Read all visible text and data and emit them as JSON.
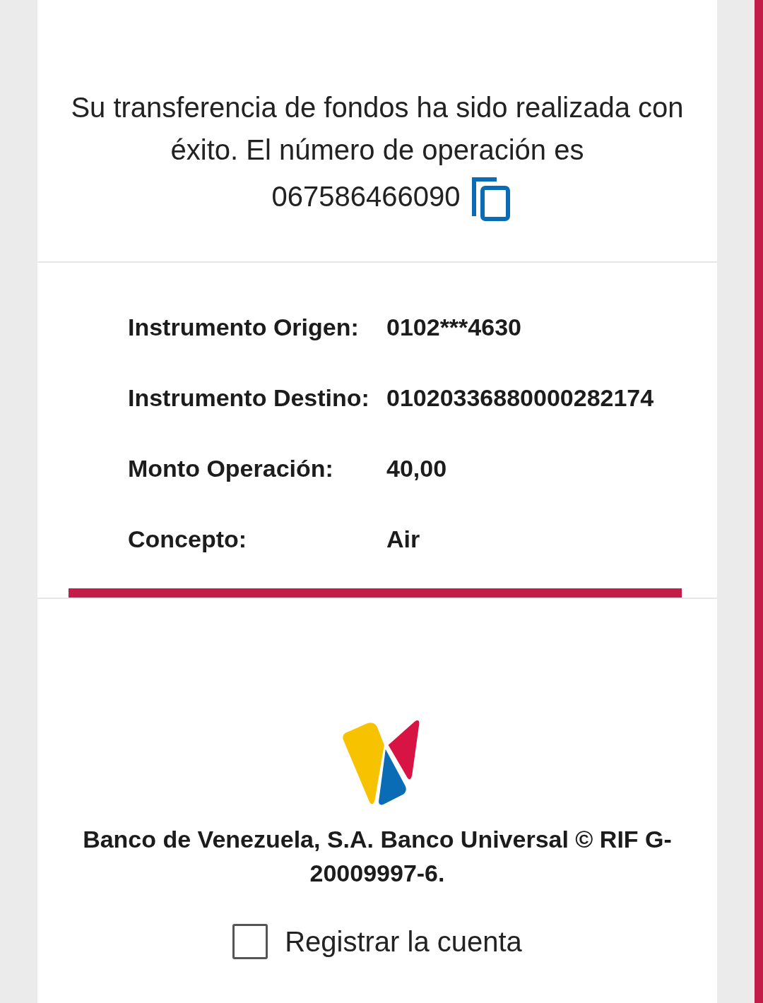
{
  "message": {
    "text": "Su transferencia de fondos ha sido realizada con éxito. El número de operación es",
    "operation_number": "067586466090"
  },
  "details": [
    {
      "label": "Instrumento Origen:",
      "value": "0102***4630"
    },
    {
      "label": "Instrumento Destino:",
      "value": "01020336880000282174"
    },
    {
      "label": "Monto Operación:",
      "value": "40,00"
    },
    {
      "label": "Concepto:",
      "value": "Air"
    }
  ],
  "footer": {
    "legal": "Banco de Venezuela, S.A. Banco Universal © RIF G-20009997-6."
  },
  "register": {
    "label": "Registrar la cuenta",
    "checked": false
  }
}
